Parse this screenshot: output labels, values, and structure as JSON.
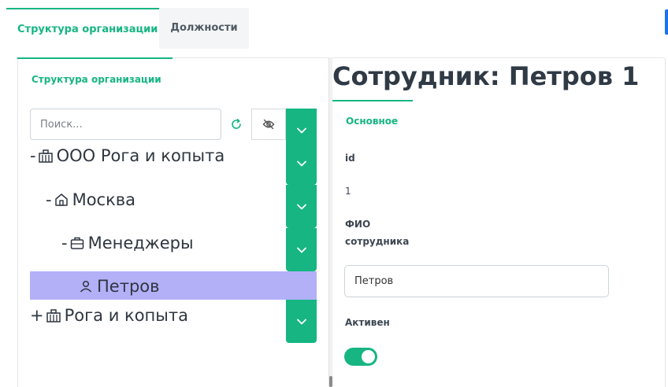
{
  "tabs": [
    {
      "label": "Структура организации",
      "active": true
    },
    {
      "label": "Должности",
      "active": false
    }
  ],
  "left_panel": {
    "title": "Структура организации",
    "search_placeholder": "Поиск..."
  },
  "tree": [
    {
      "toggle": "-",
      "icon": "building-icon",
      "label": "ООО Рога и копыта",
      "selected": false
    },
    {
      "toggle": "-",
      "icon": "home-icon",
      "label": "Москва",
      "selected": false
    },
    {
      "toggle": "-",
      "icon": "briefcase-icon",
      "label": "Менеджеры",
      "selected": false
    },
    {
      "toggle": "",
      "icon": "user-icon",
      "label": "Петров",
      "selected": true
    },
    {
      "toggle": "+",
      "icon": "building-icon",
      "label": "Рога и копыта",
      "selected": false
    }
  ],
  "employee": {
    "title": "Сотрудник: Петров 1",
    "section_tab": "Основное",
    "id_label": "id",
    "id_value": "1",
    "fio_label_line1": "ФИО",
    "fio_label_line2": "сотрудника",
    "fio_value": "Петров",
    "active_label": "Активен",
    "active_value": true
  },
  "colors": {
    "accent": "#16b582",
    "selected_row": "#b3b0f8",
    "text": "#2f3640"
  }
}
